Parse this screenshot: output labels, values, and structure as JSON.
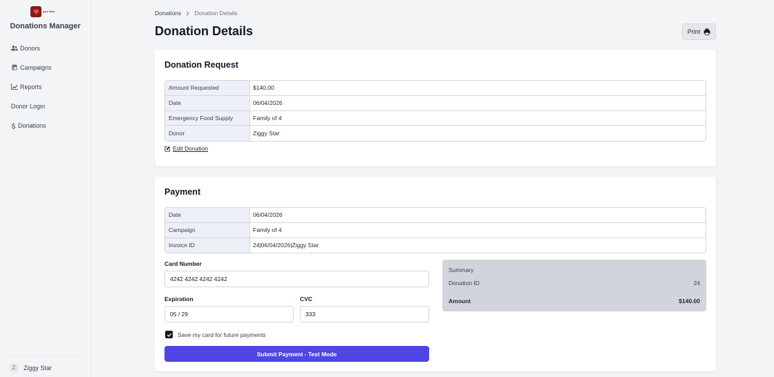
{
  "brand": {
    "logo_text": "give flow"
  },
  "sidebar": {
    "app_title": "Donations Manager",
    "items": [
      {
        "label": "Donors",
        "icon": "users-icon"
      },
      {
        "label": "Campaigns",
        "icon": "calendar-icon"
      },
      {
        "label": "Reports",
        "icon": "chart-icon"
      },
      {
        "label": "Donor Login",
        "icon": ""
      },
      {
        "label": "Donations",
        "icon": "dollar-icon"
      }
    ],
    "user": {
      "initial": "Z",
      "name": "Ziggy Star"
    }
  },
  "breadcrumb": {
    "parent": "Donations",
    "current": "Donation Details"
  },
  "page": {
    "title": "Donation Details",
    "print_label": "Print"
  },
  "request": {
    "title": "Donation Request",
    "rows": [
      {
        "key": "Amount Requested",
        "value": "$140.00"
      },
      {
        "key": "Date",
        "value": "06/04/2026"
      },
      {
        "key": "Emergency Food Supply",
        "value": "Family of 4"
      },
      {
        "key": "Donor",
        "value": "Ziggy Star"
      }
    ],
    "edit_label": "Edit Donation"
  },
  "payment": {
    "title": "Payment",
    "rows": [
      {
        "key": "Date",
        "value": "06/04/2026"
      },
      {
        "key": "Campaign",
        "value": "Family of 4"
      },
      {
        "key": "Invoice ID",
        "value": "24|06/04/2026|Ziggy Star"
      }
    ],
    "card_number_label": "Card Number",
    "card_number_value": "4242 4242 4242 4242",
    "expiration_label": "Expiration",
    "expiration_value": "05 / 29",
    "cvc_label": "CVC",
    "cvc_value": "333",
    "save_card_label": "Save my card for future payments",
    "save_card_checked": true,
    "submit_label": "Submit Payment - Test Mode"
  },
  "summary": {
    "title": "Summary",
    "donation_id_label": "Donation ID",
    "donation_id_value": "24",
    "amount_label": "Amount",
    "amount_value": "$140.00"
  },
  "colors": {
    "accent": "#4f46e5",
    "sidebar_bg": "#f3f4f6",
    "summary_bg": "#d1d5db",
    "key_bg": "#eef0f8"
  }
}
